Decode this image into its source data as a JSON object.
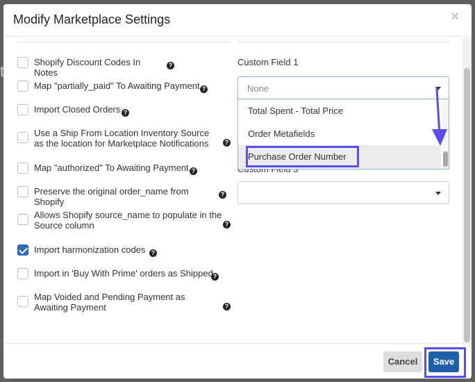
{
  "modal": {
    "title": "Modify Marketplace Settings",
    "close_label": "×"
  },
  "options": [
    {
      "label": "Shopify Discount Codes In Notes",
      "checked": false
    },
    {
      "label": "Map \"partially_paid\" To Awaiting Payment",
      "checked": false
    },
    {
      "label": "Import Closed Orders",
      "checked": false
    },
    {
      "label": "Use a Ship From Location Inventory Source as the location for Marketplace Notifications",
      "checked": false
    },
    {
      "label": "Map \"authorized\" To Awaiting Payment",
      "checked": false
    },
    {
      "label": "Preserve the original order_name from Shopify",
      "checked": false
    },
    {
      "label": "Allows Shopify source_name to populate in the Source column",
      "checked": false
    },
    {
      "label": "Import harmonization codes",
      "checked": true
    },
    {
      "label": "Import in 'Buy With Prime' orders as Shipped",
      "checked": false
    },
    {
      "label": "Map Voided and Pending Payment as Awaiting Payment",
      "checked": false
    }
  ],
  "custom_field_1": {
    "label": "Custom Field 1",
    "selected": "None",
    "options": [
      "Total Spent - Total Price",
      "Order Metafields",
      "Purchase Order Number"
    ],
    "hovered": "Purchase Order Number"
  },
  "custom_field_3": {
    "label": "Custom Field 3",
    "selected": ""
  },
  "footer": {
    "cancel_label": "Cancel",
    "save_label": "Save"
  },
  "colors": {
    "accent": "#1f5fa8",
    "annotation": "#5b4ee8",
    "checkbox_checked": "#2a6db5"
  }
}
